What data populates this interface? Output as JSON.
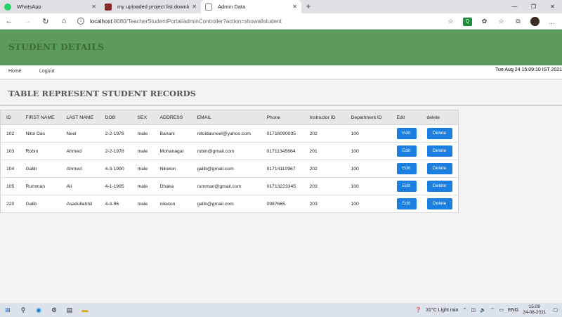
{
  "browser": {
    "tabs": [
      {
        "title": "WhatsApp",
        "favicon_color": "#25d366",
        "active": false
      },
      {
        "title": "my uploaded project list.downlo",
        "favicon_color": "#8b2a2a",
        "active": false
      },
      {
        "title": "Admin Data",
        "favicon_color": "#888888",
        "active": true
      }
    ],
    "new_tab": "+",
    "url_host": "localhost",
    "url_path": ":8080/TeacherStudentPortal/adminController?action=showallstudent"
  },
  "banner": {
    "title": "STUDENT DETAILS",
    "color": "#5c9b5c"
  },
  "menu": {
    "home": "Home",
    "logout": "Logout",
    "datetime": "Tue Aug 24 15:09:10 IST 2021"
  },
  "section": {
    "title": "TABLE REPRESENT STUDENT RECORDS"
  },
  "table": {
    "headers": [
      "ID",
      "FIRST NAME",
      "LAST NAME",
      "DOB",
      "SEX",
      "ADDRESS",
      "EMAIL",
      "Phone",
      "Instructor ID",
      "Department ID",
      "Edit",
      "delete"
    ],
    "edit_label": "Edit",
    "delete_label": "Delete",
    "rows": [
      [
        "102",
        "Nitol Das",
        "Neel",
        "2-2-1978",
        "male",
        "Banani",
        "nitoldasneel@yahoo.com",
        "01718090035",
        "202",
        "100"
      ],
      [
        "103",
        "Robin",
        "Ahmed",
        "2-2-1978",
        "male",
        "Mohanagar",
        "robin@gmail.com",
        "01711345664",
        "201",
        "100"
      ],
      [
        "104",
        "Galib",
        "Ahmed",
        "4-3-1990",
        "male",
        "Niketon",
        "galib@gmail.com",
        "01714110967",
        "202",
        "100"
      ],
      [
        "105",
        "Rumman",
        "Ali",
        "4-1-1995",
        "male",
        "Dhaka",
        "rumman@gmail.com",
        "01713223345",
        "203",
        "100"
      ],
      [
        "220",
        "Galib",
        "Asadullahhil",
        "4-4-96",
        "male",
        "niketon",
        "galib@gmail.com",
        "0987665",
        "203",
        "100"
      ]
    ],
    "button_color": "#1a7fe0"
  },
  "taskbar": {
    "weather": "31°C  Light rain",
    "lang": "ENG",
    "time": "15:09",
    "date": "24-08-2021"
  }
}
